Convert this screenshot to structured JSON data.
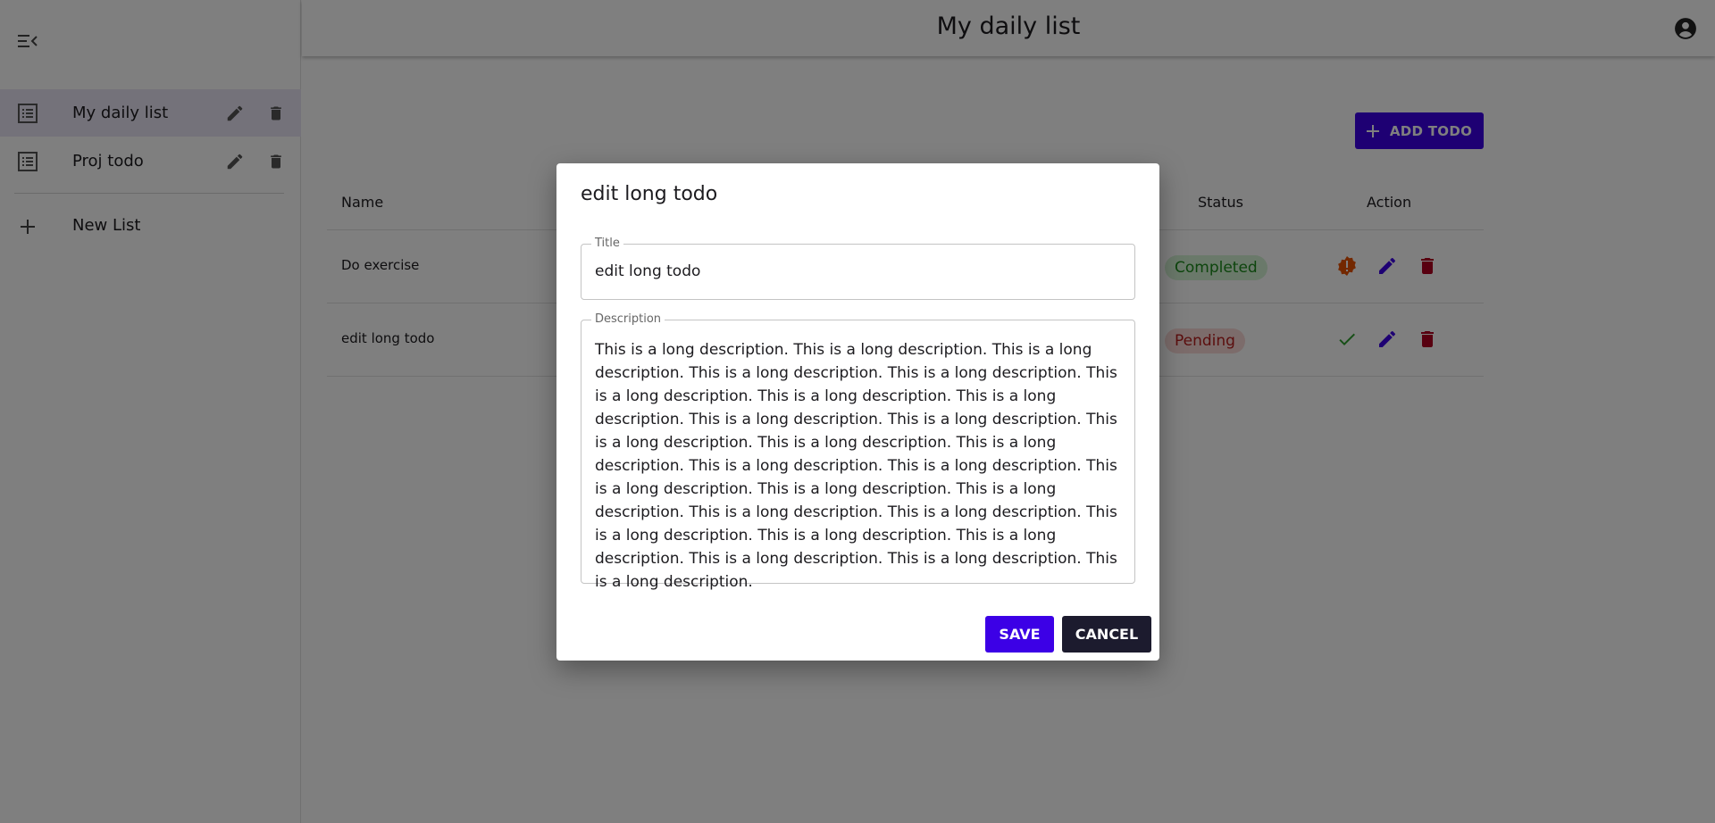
{
  "header": {
    "title": "My daily list"
  },
  "sidebar": {
    "items": [
      {
        "label": "My daily list",
        "active": true
      },
      {
        "label": "Proj todo",
        "active": false
      }
    ],
    "new_list_label": "New List"
  },
  "main": {
    "add_button_label": "ADD TODO",
    "table": {
      "columns": [
        "Name",
        "Status",
        "Action"
      ],
      "rows": [
        {
          "name": "Do exercise",
          "status": "Completed"
        },
        {
          "name": "edit long todo",
          "status": "Pending"
        }
      ]
    }
  },
  "dialog": {
    "title": "edit long todo",
    "title_field_label": "Title",
    "title_field_value": "edit long todo",
    "description_field_label": "Description",
    "description_field_value": "This is a long description. This is a long description. This is a long description. This is a long description. This is a long description. This is a long description. This is a long description. This is a long description. This is a long description. This is a long description. This is a long description. This is a long description. This is a long description. This is a long description. This is a long description. This is a long description. This is a long description. This is a long description. This is a long description. This is a long description. This is a long description. This is a long description. This is a long description. This is a long description. This is a long description. This is a long description.",
    "save_label": "SAVE",
    "cancel_label": "CANCEL"
  },
  "colors": {
    "primary": "#3c00e6",
    "completed_bg": "#d4f2d4",
    "completed_fg": "#1b8a1b",
    "pending_bg": "#f9d9d6",
    "pending_fg": "#b71c1c",
    "warning": "#e65100",
    "delete": "#b00020",
    "check": "#2e9e2e"
  }
}
